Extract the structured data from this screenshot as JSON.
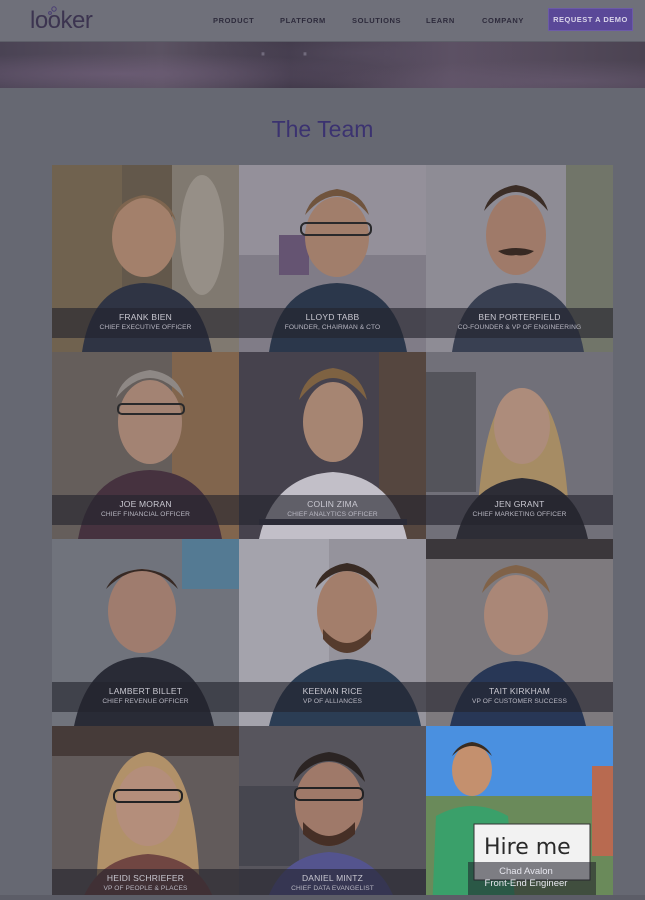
{
  "header": {
    "logo_text": "looker",
    "nav": [
      "PRODUCT",
      "PLATFORM",
      "SOLUTIONS",
      "LEARN",
      "COMPANY"
    ],
    "cta": "REQUEST A DEMO"
  },
  "section": {
    "title": "The Team"
  },
  "team": [
    {
      "name": "FRANK BIEN",
      "role": "CHIEF EXECUTIVE OFFICER"
    },
    {
      "name": "LLOYD TABB",
      "role": "FOUNDER, CHAIRMAN & CTO"
    },
    {
      "name": "BEN PORTERFIELD",
      "role": "CO-FOUNDER & VP OF ENGINEERING"
    },
    {
      "name": "JOE MORAN",
      "role": "CHIEF FINANCIAL OFFICER"
    },
    {
      "name": "COLIN ZIMA",
      "role": "CHIEF ANALYTICS OFFICER"
    },
    {
      "name": "JEN GRANT",
      "role": "CHIEF MARKETING OFFICER"
    },
    {
      "name": "LAMBERT BILLET",
      "role": "CHIEF REVENUE OFFICER"
    },
    {
      "name": "KEENAN RICE",
      "role": "VP OF ALLIANCES"
    },
    {
      "name": "TAIT KIRKHAM",
      "role": "VP OF CUSTOMER SUCCESS"
    },
    {
      "name": "HEIDI SCHRIEFER",
      "role": "VP OF PEOPLE & PLACES"
    },
    {
      "name": "DANIEL MINTZ",
      "role": "CHIEF DATA EVANGELIST"
    }
  ],
  "hire_card": {
    "sign_text": "Hire me",
    "name": "Chad Avalon",
    "role": "Front-End Engineer"
  },
  "colors": {
    "overlay": "#666872",
    "accent": "#5a4898",
    "title": "#3b3270"
  }
}
